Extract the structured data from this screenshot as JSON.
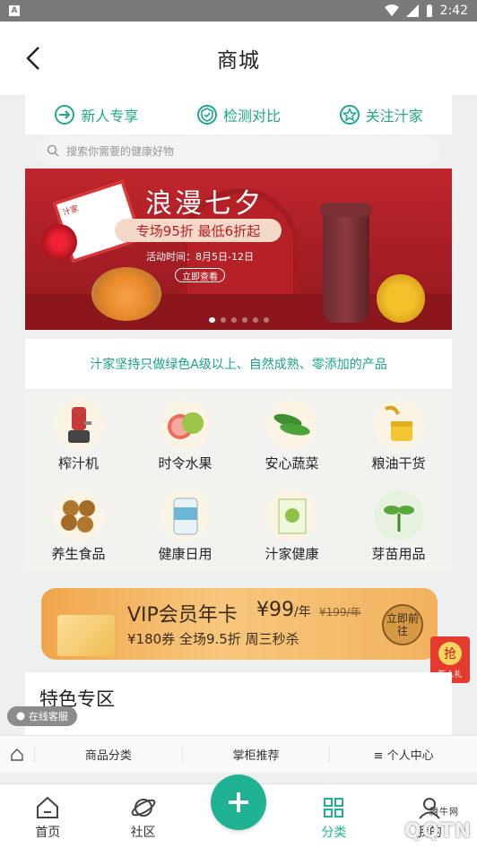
{
  "status_bar": {
    "time": "2:42"
  },
  "header": {
    "title": "商城"
  },
  "quick_links": [
    {
      "label": "新人专享",
      "icon": "login-arrow-icon"
    },
    {
      "label": "检测对比",
      "icon": "shield-check-icon"
    },
    {
      "label": "关注汁家",
      "icon": "star-icon"
    }
  ],
  "search": {
    "placeholder": "搜索你需要的健康好物"
  },
  "banner": {
    "headline": "浪漫七夕",
    "promo": "专场95折 最低6折起",
    "time": "活动时间：8月5日-12日",
    "cta": "立即查看",
    "card_text": "汁家",
    "active_index": 0,
    "slides": 6
  },
  "slogan": "汁家坚持只做绿色A级以上、自然成熟、零添加的产品",
  "categories": [
    {
      "label": "榨汁机",
      "icon": "juicer-icon"
    },
    {
      "label": "时令水果",
      "icon": "grapefruit-icon"
    },
    {
      "label": "安心蔬菜",
      "icon": "cucumber-icon"
    },
    {
      "label": "粮油干货",
      "icon": "oil-icon"
    },
    {
      "label": "养生食品",
      "icon": "nuts-icon"
    },
    {
      "label": "健康日用",
      "icon": "bottle-icon"
    },
    {
      "label": "汁家健康",
      "icon": "health-box-icon"
    },
    {
      "label": "芽苗用品",
      "icon": "sprout-icon"
    }
  ],
  "vip": {
    "title": "VIP会员年卡",
    "price": "¥99",
    "unit": "/年",
    "old_price": "¥199/年",
    "desc": "¥180券 全场9.5折 周三秒杀",
    "button": "立即前往"
  },
  "rob_badge": {
    "char": "抢",
    "label": "新人礼"
  },
  "special": {
    "title": "特色专区"
  },
  "online_service": "在线客服",
  "sub_nav": [
    "商品分类",
    "掌柜推荐",
    "≡ 个人中心"
  ],
  "tabs": [
    {
      "label": "首页",
      "icon": "house-icon"
    },
    {
      "label": "社区",
      "icon": "planet-icon"
    },
    {
      "label": "分类",
      "icon": "grid-icon"
    },
    {
      "label": "我的",
      "icon": "user-icon"
    }
  ],
  "watermark": {
    "text": "QQTN",
    "sub": "腾牛网"
  },
  "colors": {
    "accent": "#1fb394",
    "banner_red": "#b52127",
    "vip_gold": "#f2b25e"
  }
}
